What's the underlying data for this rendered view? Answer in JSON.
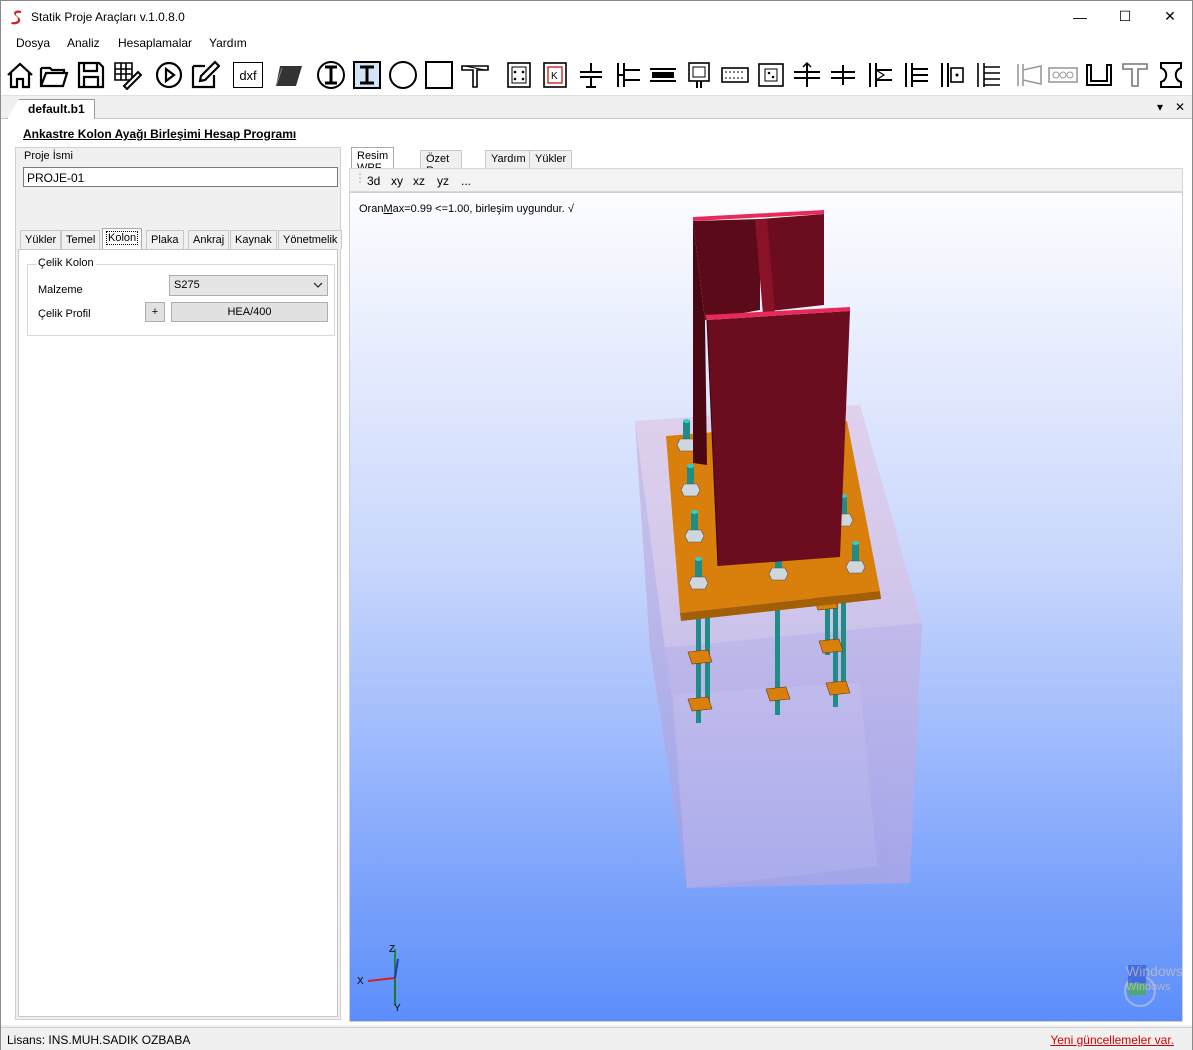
{
  "window": {
    "title": "Statik Proje Araçları v.1.0.8.0",
    "controls": {
      "minimize": "—",
      "maximize": "☐",
      "close": "✕"
    }
  },
  "menu": {
    "items": [
      "Dosya",
      "Analiz",
      "Hesaplamalar",
      "Yardım"
    ]
  },
  "toolbar": {
    "icons": [
      "home-icon",
      "open-folder-icon",
      "save-icon",
      "edit-grid-icon",
      "play-icon",
      "pencil-icon",
      "dxf-icon",
      "plate-3d-icon",
      "i-section-circle-icon",
      "i-section-box-icon",
      "circle-section-icon",
      "square-section-icon",
      "t-beam-icon",
      "column-base-plate-icon",
      "column-k-plate-icon",
      "beam-column-joint-icon",
      "end-plate-icon",
      "beam-splice-icon",
      "bolted-plate-icon",
      "flange-splice-icon",
      "web-splice-icon",
      "beam-beam-joint-icon",
      "beam-cross-icon",
      "column-flange-icon",
      "column-stiffener-icon",
      "column-web-plate-icon",
      "column-haunch-icon",
      "bracing-icon",
      "bolt-row-icon",
      "u-channel-icon",
      "t-section-icon",
      "h-section-icon"
    ],
    "dxf_label": "dxf"
  },
  "document_tab": {
    "label": "default.b1",
    "dropdown": "▾",
    "close": "✕"
  },
  "program_title": "Ankastre Kolon Ayağı Birleşimi Hesap Programı",
  "project": {
    "label": "Proje İsmi",
    "value": "PROJE-01"
  },
  "left_tabs": [
    "Yükler",
    "Temel",
    "Kolon",
    "Plaka",
    "Ankraj",
    "Kaynak",
    "Yönetmelik"
  ],
  "left_active_tab": "Kolon",
  "column_group": {
    "title": "Çelik Kolon",
    "material_label": "Malzeme",
    "material_value": "S275",
    "profile_label": "Çelik Profil",
    "add_button": "+",
    "profile_value": "HEA/400"
  },
  "right_tabs": [
    "Resim WPF",
    "Özet Rapor",
    "Yardım",
    "Yükler"
  ],
  "view_buttons": [
    "3d",
    "xy",
    "xz",
    "yz",
    "..."
  ],
  "result": {
    "ratio_prefix": "Oran",
    "ratio_underlined": "M",
    "ratio_rest": "ax=0.99 <=1.00, birleşim uygundur. √"
  },
  "axes": {
    "z": "Z",
    "x": "X",
    "y": "Y"
  },
  "watermark": {
    "line1": "Windows",
    "line2": "Windows"
  },
  "status": {
    "license": "Lisans: INS.MUH.SADIK OZBABA",
    "update": "Yeni güncellemeler var."
  },
  "colors": {
    "column_steel": "#6b0d1e",
    "column_edge": "#e8295a",
    "base_plate": "#d9800c",
    "anchor_bolt": "#1f8c86",
    "foundation": "#d4a0c8",
    "viewport_top": "#fdfdff",
    "viewport_bottom": "#5b8dfb",
    "update_link": "#d00000"
  }
}
